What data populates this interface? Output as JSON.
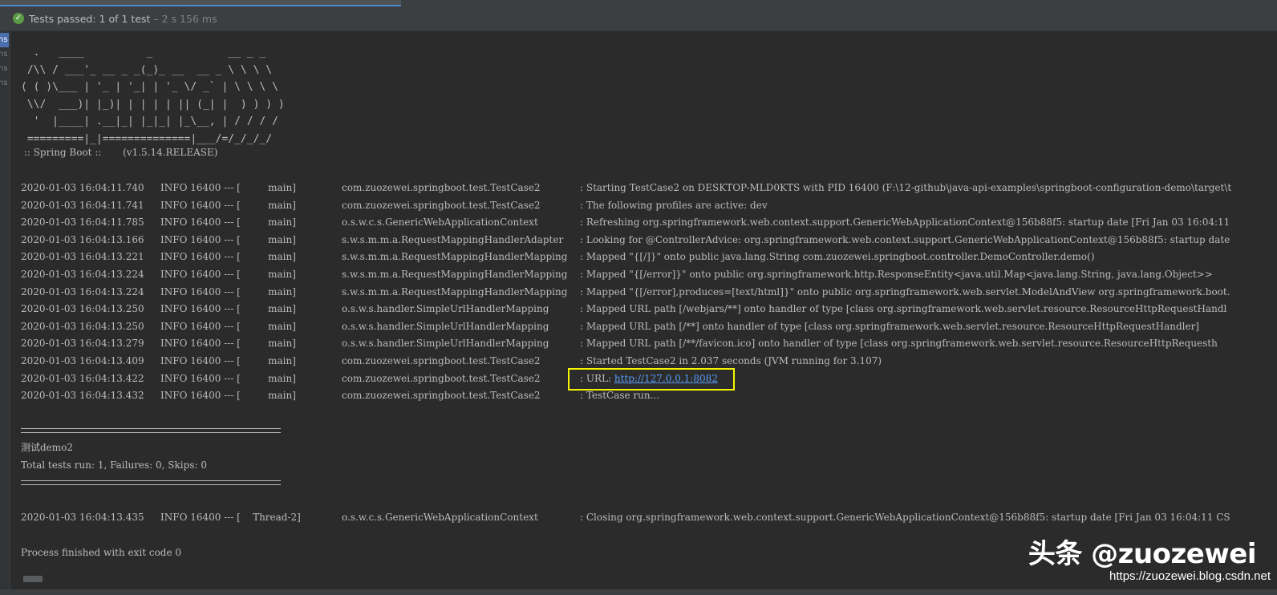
{
  "status": {
    "label": "Tests passed:",
    "count": "1",
    "of_text": "of 1 test",
    "duration": "– 2 s 156 ms"
  },
  "gutter": [
    "ns",
    "ns",
    "ns",
    "ns"
  ],
  "banner": {
    "art": "  .   ____          _            __ _ _\n /\\\\ / ___'_ __ _ _(_)_ __  __ _ \\ \\ \\ \\\n( ( )\\___ | '_ | '_| | '_ \\/ _` | \\ \\ \\ \\\n \\\\/  ___)| |_)| | | | | || (_| |  ) ) ) )\n  '  |____| .__|_| |_|_| |_\\__, | / / / /\n =========|_|==============|___/=/_/_/_/",
    "version": " :: Spring Boot ::       (v1.5.14.RELEASE)"
  },
  "logs": [
    {
      "ts": "2020-01-03 16:04:11.740",
      "lvl": "INFO 16400 --- [",
      "thr": "          main]",
      "logger": "com.zuozewei.springboot.test.TestCase2",
      "msg": ": Starting TestCase2 on DESKTOP-MLD0KTS with PID 16400 (F:\\12-github\\java-api-examples\\springboot-configuration-demo\\target\\t"
    },
    {
      "ts": "2020-01-03 16:04:11.741",
      "lvl": "INFO 16400 --- [",
      "thr": "          main]",
      "logger": "com.zuozewei.springboot.test.TestCase2",
      "msg": ": The following profiles are active: dev"
    },
    {
      "ts": "2020-01-03 16:04:11.785",
      "lvl": "INFO 16400 --- [",
      "thr": "          main]",
      "logger": "o.s.w.c.s.GenericWebApplicationContext",
      "msg": ": Refreshing org.springframework.web.context.support.GenericWebApplicationContext@156b88f5: startup date [Fri Jan 03 16:04:11"
    },
    {
      "ts": "2020-01-03 16:04:13.166",
      "lvl": "INFO 16400 --- [",
      "thr": "          main]",
      "logger": "s.w.s.m.m.a.RequestMappingHandlerAdapter",
      "msg": ": Looking for @ControllerAdvice: org.springframework.web.context.support.GenericWebApplicationContext@156b88f5: startup date"
    },
    {
      "ts": "2020-01-03 16:04:13.221",
      "lvl": "INFO 16400 --- [",
      "thr": "          main]",
      "logger": "s.w.s.m.m.a.RequestMappingHandlerMapping",
      "msg": ": Mapped \"{[/]}\" onto public java.lang.String com.zuozewei.springboot.controller.DemoController.demo()"
    },
    {
      "ts": "2020-01-03 16:04:13.224",
      "lvl": "INFO 16400 --- [",
      "thr": "          main]",
      "logger": "s.w.s.m.m.a.RequestMappingHandlerMapping",
      "msg": ": Mapped \"{[/error]}\" onto public org.springframework.http.ResponseEntity<java.util.Map<java.lang.String, java.lang.Object>>"
    },
    {
      "ts": "2020-01-03 16:04:13.224",
      "lvl": "INFO 16400 --- [",
      "thr": "          main]",
      "logger": "s.w.s.m.m.a.RequestMappingHandlerMapping",
      "msg": ": Mapped \"{[/error],produces=[text/html]}\" onto public org.springframework.web.servlet.ModelAndView org.springframework.boot."
    },
    {
      "ts": "2020-01-03 16:04:13.250",
      "lvl": "INFO 16400 --- [",
      "thr": "          main]",
      "logger": "o.s.w.s.handler.SimpleUrlHandlerMapping",
      "msg": ": Mapped URL path [/webjars/**] onto handler of type [class org.springframework.web.servlet.resource.ResourceHttpRequestHandl"
    },
    {
      "ts": "2020-01-03 16:04:13.250",
      "lvl": "INFO 16400 --- [",
      "thr": "          main]",
      "logger": "o.s.w.s.handler.SimpleUrlHandlerMapping",
      "msg": ": Mapped URL path [/**] onto handler of type [class org.springframework.web.servlet.resource.ResourceHttpRequestHandler]"
    },
    {
      "ts": "2020-01-03 16:04:13.279",
      "lvl": "INFO 16400 --- [",
      "thr": "          main]",
      "logger": "o.s.w.s.handler.SimpleUrlHandlerMapping",
      "msg": ": Mapped URL path [/**/favicon.ico] onto handler of type [class org.springframework.web.servlet.resource.ResourceHttpRequesth"
    },
    {
      "ts": "2020-01-03 16:04:13.409",
      "lvl": "INFO 16400 --- [",
      "thr": "          main]",
      "logger": "com.zuozewei.springboot.test.TestCase2",
      "msg": ": Started TestCase2 in 2.037 seconds (JVM running for 3.107)"
    },
    {
      "ts": "2020-01-03 16:04:13.422",
      "lvl": "INFO 16400 --- [",
      "thr": "          main]",
      "logger": "com.zuozewei.springboot.test.TestCase2",
      "msg_prefix": ": URL: ",
      "msg_link": "http://127.0.0.1:8082"
    },
    {
      "ts": "2020-01-03 16:04:13.432",
      "lvl": "INFO 16400 --- [",
      "thr": "          main]",
      "logger": "com.zuozewei.springboot.test.TestCase2",
      "msg": ": TestCase run..."
    }
  ],
  "summary": {
    "suite": "测试demo2",
    "totals": "Total tests run: 1, Failures: 0, Skips: 0"
  },
  "closing_log": {
    "ts": "2020-01-03 16:04:13.435",
    "lvl": "INFO 16400 --- [",
    "thr": "     Thread-2]",
    "logger": "o.s.w.c.s.GenericWebApplicationContext",
    "msg": ": Closing org.springframework.web.context.support.GenericWebApplicationContext@156b88f5: startup date [Fri Jan 03 16:04:11 CS"
  },
  "exit_message": "Process finished with exit code 0",
  "watermark": {
    "text": "头条 @zuozewei",
    "url": "https://zuozewei.blog.csdn.net"
  },
  "colors": {
    "background": "#2b2b2b",
    "text": "#bbbbbb",
    "link": "#589df6",
    "highlight": "#f6f600",
    "pass": "#5b9b47"
  }
}
